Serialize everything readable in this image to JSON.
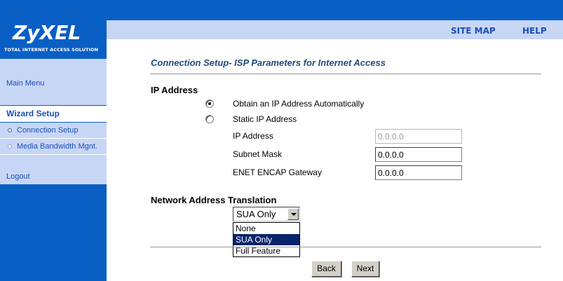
{
  "brand": {
    "logo": "ZyXEL",
    "tagline": "TOTAL INTERNET ACCESS SOLUTION",
    "color": "#0a5fc4"
  },
  "header": {
    "site_map": "SITE MAP",
    "help": "HELP"
  },
  "sidebar": {
    "main_menu": "Main Menu",
    "wizard_setup": "Wizard Setup",
    "connection_setup": "Connection Setup",
    "media_bandwidth": "Media Bandwidth Mgnt.",
    "logout": "Logout"
  },
  "page": {
    "title": "Connection Setup- ISP Parameters for Internet Access"
  },
  "ip_section": {
    "title": "IP Address",
    "obtain_auto": "Obtain an IP Address Automatically",
    "static_ip": "Static IP Address",
    "selected": "obtain_auto",
    "ip_address_label": "IP Address",
    "ip_address_value": "0.0.0.0",
    "subnet_mask_label": "Subnet Mask",
    "subnet_mask_value": "0.0.0.0",
    "gateway_label": "ENET ENCAP Gateway",
    "gateway_value": "0.0.0.0"
  },
  "nat_section": {
    "title": "Network Address Translation",
    "selected_value": "SUA Only",
    "options": [
      "None",
      "SUA Only",
      "Full Feature"
    ]
  },
  "buttons": {
    "back": "Back",
    "next": "Next"
  }
}
